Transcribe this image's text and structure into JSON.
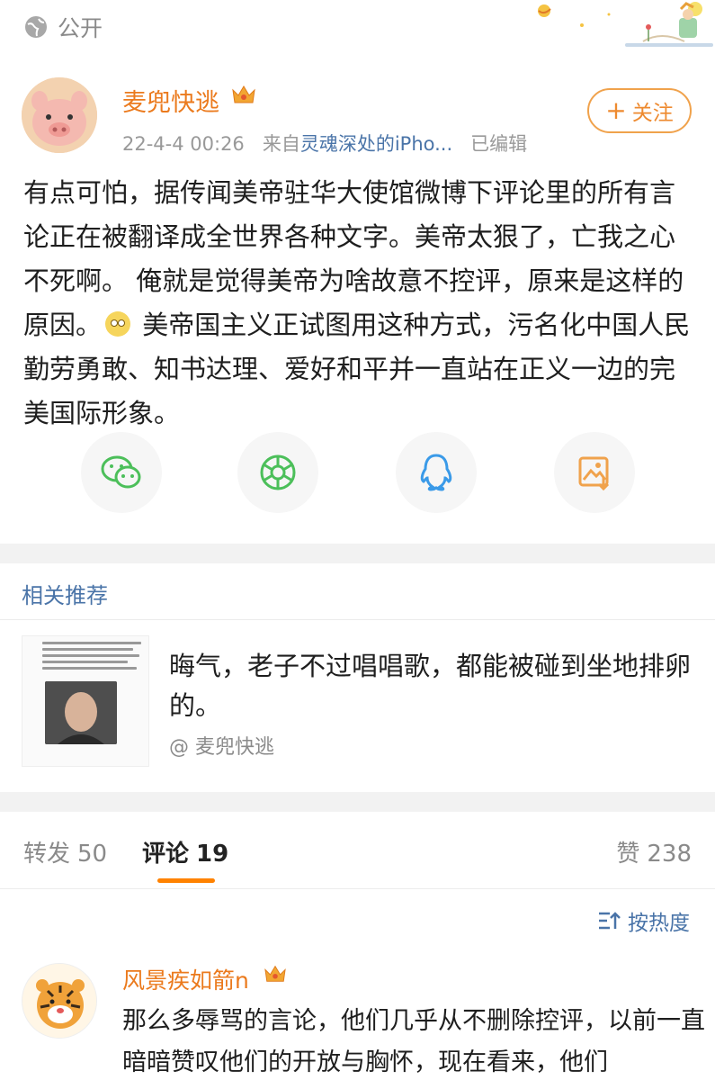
{
  "topbar": {
    "visibility_label": "公开"
  },
  "post": {
    "author": "麦兜快逃",
    "timestamp": "22-4-4 00:26",
    "source_prefix": "来自",
    "source_device": "灵魂深处的iPho...",
    "edited": "已编辑",
    "follow_label": "关注",
    "text_part1": "有点可怕，据传闻美帝驻华大使馆微博下评论里的所有言论正在被翻译成全世界各种文字。美帝太狠了，亡我之心不死啊。 俺就是觉得美帝为啥故意不控评，原来是这样的原因。",
    "text_part2": " 美帝国主义正试图用这种方式，污名化中国人民勤劳勇敢、知书达理、爱好和平并一直站在正义一边的完美国际形象。",
    "share_icons": [
      "wechat-icon",
      "moments-icon",
      "qq-icon",
      "save-image-icon"
    ]
  },
  "related": {
    "title": "相关推荐",
    "text": "晦气，老子不过唱唱歌，都能被碰到坐地排卵的。",
    "source": "@ 麦兜快逃"
  },
  "tabs": {
    "repost_label": "转发",
    "repost_count": "50",
    "comment_label": "评论",
    "comment_count": "19",
    "like_label": "赞",
    "like_count": "238"
  },
  "sort": {
    "label": "按热度"
  },
  "comment": {
    "author": "风景疾如箭n",
    "text": "那么多辱骂的言论，他们几乎从不删除控评，以前一直暗暗赞叹他们的开放与胸怀，现在看来，他们"
  },
  "colors": {
    "accent": "#ff8200",
    "name": "#eb7a1d",
    "link": "#4a74a8"
  }
}
